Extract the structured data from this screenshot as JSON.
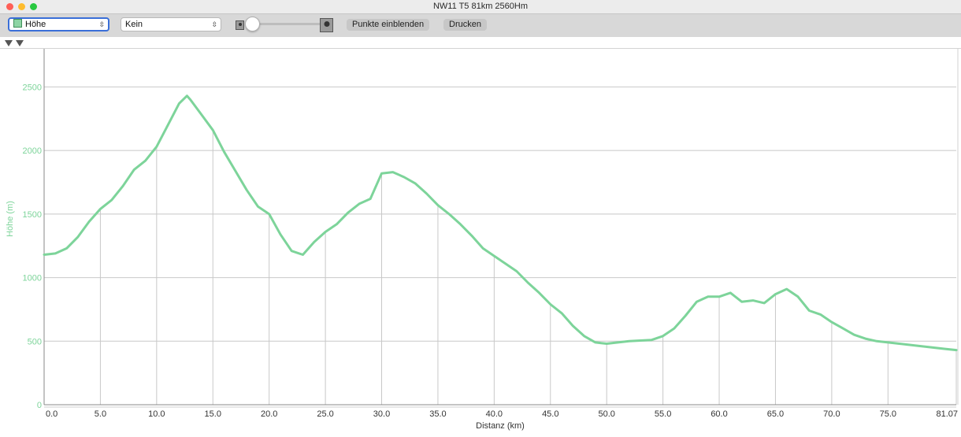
{
  "window": {
    "title": "NW11 T5 81km 2560Hm"
  },
  "toolbar": {
    "primary_select": "Höhe",
    "secondary_select": "Kein",
    "show_points_button": "Punkte einblenden",
    "print_button": "Drucken"
  },
  "colors": {
    "series": "#7dd49a",
    "axis_label": "#7dd49a",
    "grid": "#c8c8c8"
  },
  "chart_data": {
    "type": "area",
    "xlabel": "Distanz (km)",
    "ylabel": "Höhe (m)",
    "xlim": [
      0,
      81.07
    ],
    "ylim": [
      0,
      2800
    ],
    "x_ticks": [
      "0.0",
      "5.0",
      "10.0",
      "15.0",
      "20.0",
      "25.0",
      "30.0",
      "35.0",
      "40.0",
      "45.0",
      "50.0",
      "55.0",
      "60.0",
      "65.0",
      "70.0",
      "75.0",
      "81.07"
    ],
    "x_tick_values": [
      0,
      5,
      10,
      15,
      20,
      25,
      30,
      35,
      40,
      45,
      50,
      55,
      60,
      65,
      70,
      75,
      81.07
    ],
    "y_ticks": [
      "0",
      "500",
      "1000",
      "1500",
      "2000",
      "2500"
    ],
    "y_tick_values": [
      0,
      500,
      1000,
      1500,
      2000,
      2500
    ],
    "series": [
      {
        "x": [
          0,
          1,
          2,
          3,
          4,
          5,
          6,
          7,
          8,
          9,
          10,
          11,
          12,
          12.7,
          13,
          14,
          15,
          16,
          17,
          18,
          19,
          20,
          21,
          22,
          23,
          24,
          25,
          26,
          27,
          28,
          29,
          30,
          31,
          32,
          33,
          34,
          35,
          36,
          37,
          38,
          39,
          40,
          41,
          42,
          43,
          44,
          45,
          46,
          47,
          48,
          49,
          50,
          51,
          52,
          53,
          54,
          55,
          56,
          57,
          58,
          59,
          60,
          61,
          62,
          63,
          64,
          65,
          66,
          67,
          68,
          69,
          70,
          71,
          72,
          73,
          74,
          75,
          76,
          77,
          78,
          79,
          80,
          81.07
        ],
        "y": [
          1180,
          1190,
          1230,
          1320,
          1440,
          1540,
          1610,
          1720,
          1850,
          1920,
          2030,
          2200,
          2370,
          2430,
          2400,
          2280,
          2160,
          1990,
          1840,
          1690,
          1560,
          1500,
          1340,
          1210,
          1180,
          1280,
          1360,
          1420,
          1510,
          1580,
          1620,
          1820,
          1830,
          1790,
          1740,
          1660,
          1570,
          1500,
          1420,
          1330,
          1230,
          1170,
          1110,
          1050,
          960,
          880,
          790,
          720,
          620,
          540,
          490,
          480,
          490,
          500,
          505,
          510,
          540,
          600,
          700,
          810,
          850,
          850,
          880,
          810,
          820,
          800,
          870,
          910,
          850,
          740,
          710,
          650,
          600,
          550,
          520,
          500,
          490,
          480,
          470,
          460,
          450,
          440,
          430
        ]
      }
    ]
  }
}
